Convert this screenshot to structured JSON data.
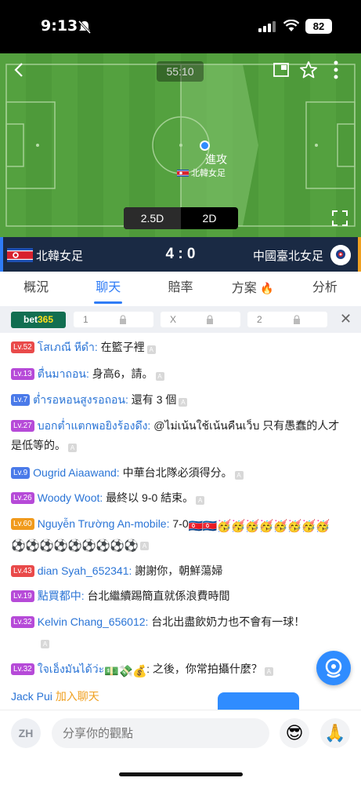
{
  "status": {
    "time": "9:13",
    "battery": "82"
  },
  "match": {
    "timer": "55:10",
    "attack_label": "進攻",
    "attack_team": "北韓女足",
    "view_25d": "2.5D",
    "view_2d": "2D",
    "home": "北韓女足",
    "away": "中國臺北女足",
    "score": "4 : 0"
  },
  "tabs": [
    {
      "label": "概況"
    },
    {
      "label": "聊天"
    },
    {
      "label": "賠率"
    },
    {
      "label": "方案"
    },
    {
      "label": "分析"
    }
  ],
  "odds": {
    "brand_a": "bet",
    "brand_b": "365",
    "labels": [
      "1",
      "X",
      "2"
    ]
  },
  "messages": [
    {
      "lv": "Lv.52",
      "color": "red",
      "user": "โสเภณี หีดำ:",
      "text": " 在籃子裡"
    },
    {
      "lv": "Lv.13",
      "color": "purple",
      "user": "ตื่นมาถอน:",
      "text": " 身高6，請。"
    },
    {
      "lv": "Lv.7",
      "color": "blue",
      "user": "ต่ำรอหอนสูงรอถอน:",
      "text": " 還有 3 個"
    },
    {
      "lv": "Lv.27",
      "color": "purple",
      "user": "บอกต่ำแตกพอยิงร้องดึง:",
      "text": " @ไม่เน้นใช้เน้นคืนเว็บ 只有愚蠢的人才是低等的。"
    },
    {
      "lv": "Lv.9",
      "color": "blue",
      "user": "Ougrid Aiaawand:",
      "text": " 中華台北隊必須得分。"
    },
    {
      "lv": "Lv.26",
      "color": "purple",
      "user": "Woody Woot:",
      "text": " 最終以 9-0 結束。"
    },
    {
      "lv": "Lv.60",
      "color": "orange",
      "user": "Nguyễn Trường An-mobile:",
      "text": " 7-0"
    },
    {
      "lv": "Lv.43",
      "color": "red",
      "user": "dian Syah_652341:",
      "text": " 謝謝你，朝鮮蕩婦"
    },
    {
      "lv": "Lv.19",
      "color": "purple",
      "user": "點買都中:",
      "text": " 台北繼續踢簡直就係浪費時間"
    },
    {
      "lv": "Lv.32",
      "color": "purple",
      "user": "Kelvin Chang_656012:",
      "text": " 台北出盡飲奶力也不會有一球！"
    },
    {
      "lv": "Lv.32",
      "color": "purple",
      "user": "ใจเอ็งมันได้ว่ะ",
      "text": ": 之後，你常拍攝什麼？"
    }
  ],
  "join": {
    "user": "Jack Pui",
    "action": "加入聊天"
  },
  "input": {
    "lang": "ZH",
    "placeholder": "分享你的觀點"
  },
  "colors": {
    "accent": "#2f7cf6",
    "score_bg": "#1a2a44",
    "pitch": "#4e9a3a"
  }
}
